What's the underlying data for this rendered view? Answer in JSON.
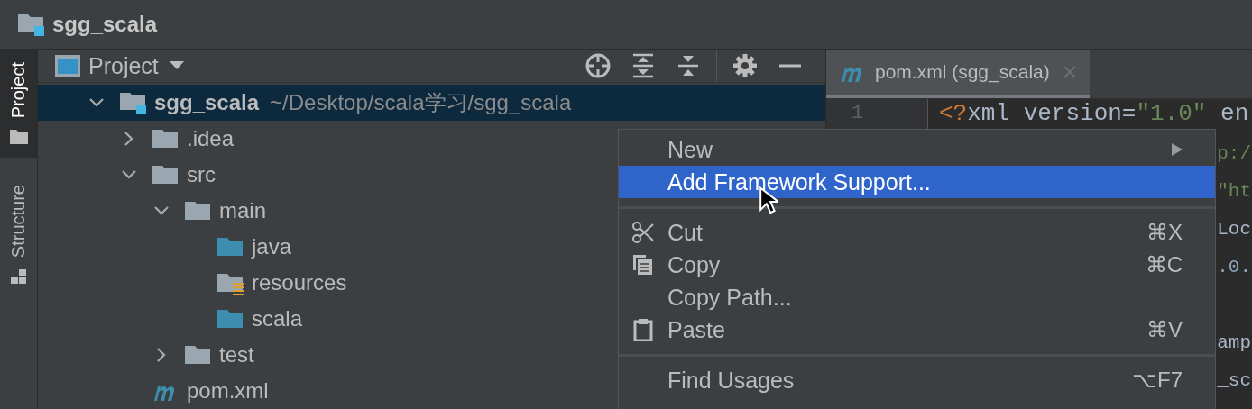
{
  "title_bar": {
    "project": "sgg_scala"
  },
  "tool_strip": [
    {
      "label": "Project",
      "selected": true
    },
    {
      "label": "Structure",
      "selected": false
    }
  ],
  "project_panel": {
    "view": "Project",
    "tree": [
      {
        "name": "sgg_scala",
        "path": "~/Desktop/scala学习/sgg_scala",
        "kind": "module",
        "expanded": true,
        "selected": true,
        "children": [
          {
            "name": ".idea",
            "kind": "folder",
            "expanded": false,
            "selected": false
          },
          {
            "name": "src",
            "kind": "folder",
            "expanded": true,
            "selected": false,
            "children": [
              {
                "name": "main",
                "kind": "folder",
                "expanded": true,
                "selected": false,
                "children": [
                  {
                    "name": "java",
                    "kind": "source",
                    "selected": false
                  },
                  {
                    "name": "resources",
                    "kind": "resources",
                    "selected": false
                  },
                  {
                    "name": "scala",
                    "kind": "source",
                    "selected": false
                  }
                ]
              },
              {
                "name": "test",
                "kind": "folder",
                "expanded": false,
                "selected": false
              }
            ]
          },
          {
            "name": "pom.xml",
            "kind": "maven",
            "selected": false
          }
        ]
      }
    ]
  },
  "editor": {
    "tabs": [
      {
        "label": "pom.xml (sgg_scala)",
        "selected": true
      }
    ],
    "gutter": [
      "1"
    ],
    "code_lines": [
      {
        "kind": "full",
        "segments": [
          {
            "text": "<?",
            "kind": "punct"
          },
          {
            "text": "xml version=",
            "kind": "plain"
          },
          {
            "text": "\"1.0\"",
            "kind": "string"
          },
          {
            "text": " en",
            "kind": "plain"
          }
        ]
      },
      {
        "kind": "fragment",
        "segments": [
          {
            "text": "p:/",
            "kind": "string"
          }
        ]
      },
      {
        "kind": "fragment",
        "segments": [
          {
            "text": "\"ht",
            "kind": "string"
          }
        ]
      },
      {
        "kind": "fragment",
        "segments": [
          {
            "text": "Loc",
            "kind": "plain"
          }
        ]
      },
      {
        "kind": "fragment",
        "segments": [
          {
            "text": ".0.",
            "kind": "number"
          }
        ]
      },
      {
        "kind": "blank"
      },
      {
        "kind": "fragment",
        "segments": [
          {
            "text": "amp",
            "kind": "plain"
          }
        ]
      },
      {
        "kind": "fragment",
        "segments": [
          {
            "text": "_sc",
            "kind": "plain"
          }
        ]
      }
    ]
  },
  "context_menu": [
    {
      "kind": "item",
      "label": "New",
      "submenu": true,
      "selected": false
    },
    {
      "kind": "item",
      "label": "Add Framework Support...",
      "selected": true
    },
    {
      "kind": "separator"
    },
    {
      "kind": "item",
      "label": "Cut",
      "shortcut": "⌘X",
      "selected": false
    },
    {
      "kind": "item",
      "label": "Copy",
      "shortcut": "⌘C",
      "selected": false
    },
    {
      "kind": "item",
      "label": "Copy Path...",
      "selected": false
    },
    {
      "kind": "item",
      "label": "Paste",
      "shortcut": "⌘V",
      "selected": false
    },
    {
      "kind": "separator"
    },
    {
      "kind": "item",
      "label": "Find Usages",
      "shortcut": "⌥F7",
      "selected": false
    }
  ]
}
